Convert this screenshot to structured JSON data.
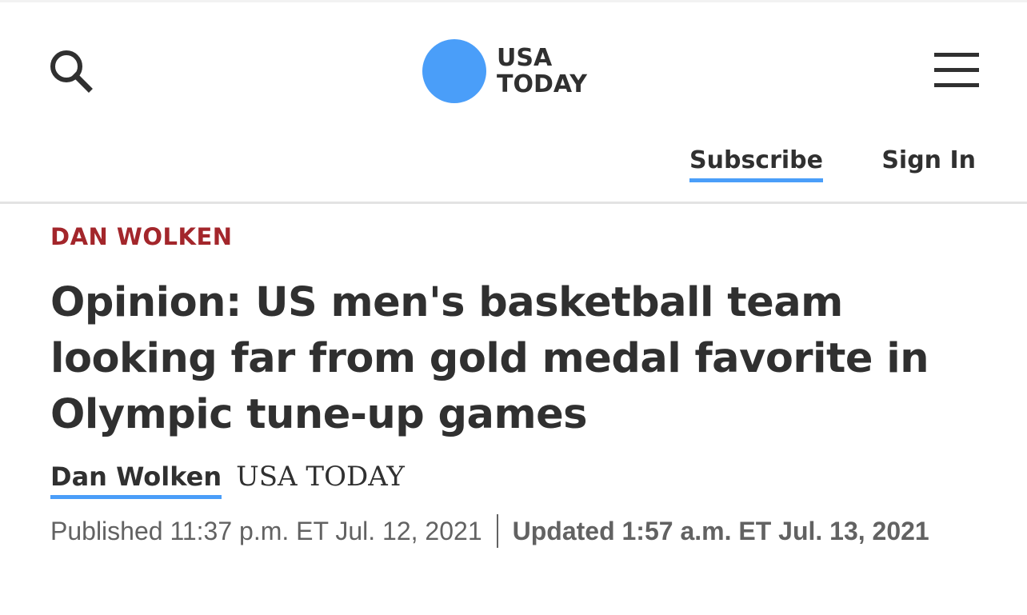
{
  "header": {
    "logo_line1": "USA",
    "logo_line2": "TODAY",
    "subscribe_label": "Subscribe",
    "signin_label": "Sign In",
    "icons": {
      "search": "search-icon",
      "menu": "hamburger-menu-icon"
    }
  },
  "article": {
    "column": "DAN WOLKEN",
    "headline": "Opinion: US men's basketball team looking far from gold medal favorite in Olympic tune-up games",
    "author": "Dan Wolken",
    "publication": "USA TODAY",
    "published": "Published 11:37 p.m. ET Jul. 12, 2021",
    "updated": "Updated 1:57 a.m. ET Jul. 13, 2021"
  },
  "colors": {
    "accent_blue": "#4a9ef9",
    "column_red": "#a3262b",
    "text_dark": "#303030",
    "text_gray": "#626262"
  }
}
